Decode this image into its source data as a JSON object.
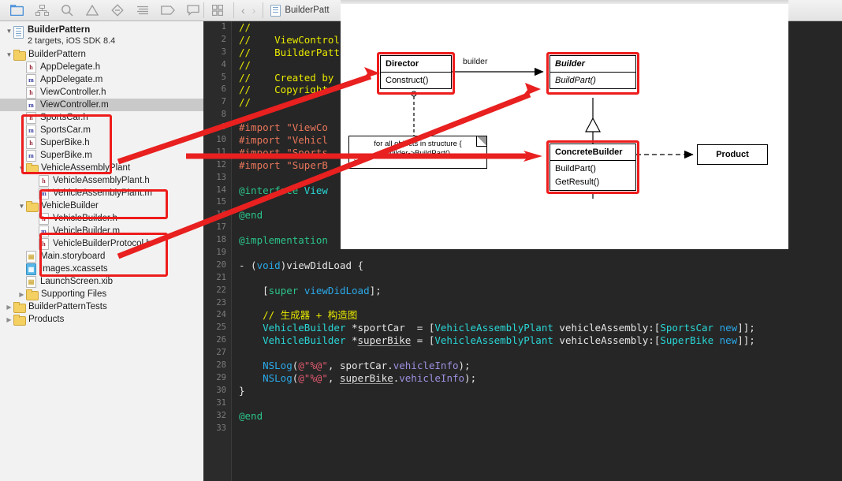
{
  "toolbar": {
    "icons": [
      {
        "name": "folder-navigator-icon",
        "active": true
      },
      {
        "name": "hierarchy-navigator-icon",
        "active": false
      },
      {
        "name": "search-navigator-icon",
        "active": false
      },
      {
        "name": "issue-navigator-icon",
        "active": false
      },
      {
        "name": "test-navigator-icon",
        "active": false
      },
      {
        "name": "debug-navigator-icon",
        "active": false
      },
      {
        "name": "breakpoint-navigator-icon",
        "active": false
      },
      {
        "name": "report-navigator-icon",
        "active": false
      }
    ],
    "grid_icon": "grid-view-icon",
    "back_label": "‹",
    "forward_label": "›",
    "breadcrumb": "BuilderPatt"
  },
  "sidebar": {
    "project": {
      "name": "BuilderPattern",
      "subtitle": "2 targets, iOS SDK 8.4"
    },
    "items": [
      {
        "label": "BuilderPattern",
        "kind": "folder",
        "indent": 1,
        "disclosure": "open"
      },
      {
        "label": "AppDelegate.h",
        "kind": "h",
        "indent": 2
      },
      {
        "label": "AppDelegate.m",
        "kind": "m",
        "indent": 2
      },
      {
        "label": "ViewController.h",
        "kind": "h",
        "indent": 2
      },
      {
        "label": "ViewController.m",
        "kind": "m",
        "indent": 2,
        "selected": true
      },
      {
        "label": "SportsCar.h",
        "kind": "h",
        "indent": 2
      },
      {
        "label": "SportsCar.m",
        "kind": "m",
        "indent": 2
      },
      {
        "label": "SuperBike.h",
        "kind": "h",
        "indent": 2
      },
      {
        "label": "SuperBike.m",
        "kind": "m",
        "indent": 2
      },
      {
        "label": "VehicleAssemblyPlant",
        "kind": "folder",
        "indent": 2,
        "disclosure": "open"
      },
      {
        "label": "VehicleAssemblyPlant.h",
        "kind": "h",
        "indent": 3
      },
      {
        "label": "VehicleAssemblyPlant.m",
        "kind": "m",
        "indent": 3
      },
      {
        "label": "VehicleBuilder",
        "kind": "folder",
        "indent": 2,
        "disclosure": "open"
      },
      {
        "label": "VehicleBuilder.h",
        "kind": "h",
        "indent": 3
      },
      {
        "label": "VehicleBuilder.m",
        "kind": "m",
        "indent": 3
      },
      {
        "label": "VehicleBuilderProtocol.h",
        "kind": "h",
        "indent": 3
      },
      {
        "label": "Main.storyboard",
        "kind": "sb",
        "indent": 2
      },
      {
        "label": "Images.xcassets",
        "kind": "xc",
        "indent": 2
      },
      {
        "label": "LaunchScreen.xib",
        "kind": "xib",
        "indent": 2
      },
      {
        "label": "Supporting Files",
        "kind": "folder",
        "indent": 2,
        "disclosure": "closed"
      },
      {
        "label": "BuilderPatternTests",
        "kind": "folder",
        "indent": 1,
        "disclosure": "closed"
      },
      {
        "label": "Products",
        "kind": "folder",
        "indent": 1,
        "disclosure": "closed"
      }
    ]
  },
  "editor": {
    "lines": [
      {
        "n": 1,
        "segs": [
          {
            "t": "//",
            "c": "cmt"
          }
        ]
      },
      {
        "n": 2,
        "segs": [
          {
            "t": "//    ViewControl",
            "c": "cmt"
          }
        ]
      },
      {
        "n": 3,
        "segs": [
          {
            "t": "//    BuilderPatt",
            "c": "cmt"
          }
        ]
      },
      {
        "n": 4,
        "segs": [
          {
            "t": "//",
            "c": "cmt"
          }
        ]
      },
      {
        "n": 5,
        "segs": [
          {
            "t": "//    Created by",
            "c": "cmt"
          }
        ]
      },
      {
        "n": 6,
        "segs": [
          {
            "t": "//    Copyright ",
            "c": "cmt"
          }
        ]
      },
      {
        "n": 7,
        "segs": [
          {
            "t": "//",
            "c": "cmt"
          }
        ]
      },
      {
        "n": 8,
        "segs": []
      },
      {
        "n": 9,
        "segs": [
          {
            "t": "#import ",
            "c": "pre"
          },
          {
            "t": "\"ViewCo",
            "c": "str"
          }
        ]
      },
      {
        "n": 10,
        "segs": [
          {
            "t": "#import ",
            "c": "pre"
          },
          {
            "t": "\"Vehicl",
            "c": "str"
          }
        ]
      },
      {
        "n": 11,
        "segs": [
          {
            "t": "#import ",
            "c": "pre"
          },
          {
            "t": "\"Sports",
            "c": "str"
          }
        ]
      },
      {
        "n": 12,
        "segs": [
          {
            "t": "#import ",
            "c": "pre"
          },
          {
            "t": "\"SuperB",
            "c": "str"
          }
        ]
      },
      {
        "n": 13,
        "segs": []
      },
      {
        "n": 14,
        "segs": [
          {
            "t": "@interface ",
            "c": "kw"
          },
          {
            "t": "View",
            "c": "typ"
          }
        ]
      },
      {
        "n": 15,
        "segs": []
      },
      {
        "n": 16,
        "segs": [
          {
            "t": "@end",
            "c": "kw"
          }
        ]
      },
      {
        "n": 17,
        "segs": []
      },
      {
        "n": 18,
        "segs": [
          {
            "t": "@implementation ",
            "c": "kw"
          }
        ]
      },
      {
        "n": 19,
        "segs": []
      },
      {
        "n": 20,
        "segs": [
          {
            "t": "- (",
            "c": "pln"
          },
          {
            "t": "void",
            "c": "kw2"
          },
          {
            "t": ")viewDidLoad {",
            "c": "pln"
          }
        ]
      },
      {
        "n": 21,
        "segs": []
      },
      {
        "n": 22,
        "segs": [
          {
            "t": "    [",
            "c": "pln"
          },
          {
            "t": "super",
            "c": "kw"
          },
          {
            "t": " ",
            "c": "pln"
          },
          {
            "t": "viewDidLoad",
            "c": "kw2"
          },
          {
            "t": "];",
            "c": "pln"
          }
        ]
      },
      {
        "n": 23,
        "segs": []
      },
      {
        "n": 24,
        "segs": [
          {
            "t": "    // 生成器 + 构造图",
            "c": "cmt"
          }
        ]
      },
      {
        "n": 25,
        "segs": [
          {
            "t": "    ",
            "c": "pln"
          },
          {
            "t": "VehicleBuilder",
            "c": "typ"
          },
          {
            "t": " *sportCar  = [",
            "c": "pln"
          },
          {
            "t": "VehicleAssemblyPlant",
            "c": "typ"
          },
          {
            "t": " vehicleAssembly:[",
            "c": "pln"
          },
          {
            "t": "SportsCar",
            "c": "typ"
          },
          {
            "t": " ",
            "c": "pln"
          },
          {
            "t": "new",
            "c": "kw2"
          },
          {
            "t": "]];",
            "c": "pln"
          }
        ]
      },
      {
        "n": 26,
        "segs": [
          {
            "t": "    ",
            "c": "pln"
          },
          {
            "t": "VehicleBuilder",
            "c": "typ"
          },
          {
            "t": " *",
            "c": "pln"
          },
          {
            "t": "superBike",
            "c": "pln und"
          },
          {
            "t": " = [",
            "c": "pln"
          },
          {
            "t": "VehicleAssemblyPlant",
            "c": "typ"
          },
          {
            "t": " vehicleAssembly:[",
            "c": "pln"
          },
          {
            "t": "SuperBike",
            "c": "typ"
          },
          {
            "t": " ",
            "c": "pln"
          },
          {
            "t": "new",
            "c": "kw2"
          },
          {
            "t": "]];",
            "c": "pln"
          }
        ]
      },
      {
        "n": 27,
        "segs": []
      },
      {
        "n": 28,
        "segs": [
          {
            "t": "    ",
            "c": "pln"
          },
          {
            "t": "NSLog",
            "c": "kw2"
          },
          {
            "t": "(",
            "c": "pln"
          },
          {
            "t": "@\"%@\"",
            "c": "strs"
          },
          {
            "t": ", sportCar.",
            "c": "pln"
          },
          {
            "t": "vehicleInfo",
            "c": "prop"
          },
          {
            "t": ");",
            "c": "pln"
          }
        ]
      },
      {
        "n": 29,
        "segs": [
          {
            "t": "    ",
            "c": "pln"
          },
          {
            "t": "NSLog",
            "c": "kw2"
          },
          {
            "t": "(",
            "c": "pln"
          },
          {
            "t": "@\"%@\"",
            "c": "strs"
          },
          {
            "t": ", ",
            "c": "pln"
          },
          {
            "t": "superBike",
            "c": "pln und"
          },
          {
            "t": ".",
            "c": "pln"
          },
          {
            "t": "vehicleInfo",
            "c": "prop"
          },
          {
            "t": ");",
            "c": "pln"
          }
        ]
      },
      {
        "n": 30,
        "segs": [
          {
            "t": "}",
            "c": "pln"
          }
        ]
      },
      {
        "n": 31,
        "segs": []
      },
      {
        "n": 32,
        "segs": [
          {
            "t": "@end",
            "c": "kw"
          }
        ]
      },
      {
        "n": 33,
        "segs": []
      }
    ]
  },
  "diagram": {
    "boxes": [
      {
        "id": "director",
        "title": "Director",
        "title_italic": false,
        "methods": [
          "Construct()"
        ],
        "methods_italic": false,
        "highlighted": true
      },
      {
        "id": "builder",
        "title": "Builder",
        "title_italic": true,
        "methods": [
          "BuildPart()"
        ],
        "methods_italic": true,
        "highlighted": true
      },
      {
        "id": "concretebuilder",
        "title": "ConcreteBuilder",
        "title_italic": false,
        "methods": [
          "BuildPart()",
          "GetResult()"
        ],
        "methods_italic": false,
        "highlighted": true
      },
      {
        "id": "product",
        "title": "Product",
        "title_italic": false,
        "methods": [],
        "methods_italic": false,
        "highlighted": false
      }
    ],
    "association_label": "builder",
    "note_lines": [
      "for all objects in structure {",
      "builder->BuildPart()",
      "}"
    ]
  },
  "colors": {
    "highlight_red": "#ee1c1c",
    "editor_background": "#262626",
    "sidebar_background": "#f2f2f2",
    "selection_gray": "#c9c9c9",
    "accent_blue": "#4a90d9"
  }
}
